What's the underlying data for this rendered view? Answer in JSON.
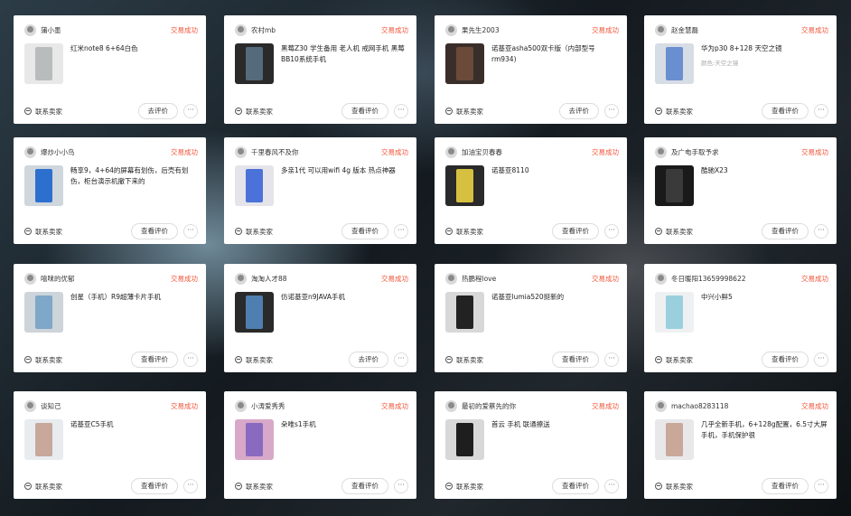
{
  "cards": [
    {
      "seller": "蒲小墨",
      "status": "交易成功",
      "title": "红米note8 6+64白色",
      "sub": "",
      "contact": "联系卖家",
      "review": "去评价",
      "more": "···",
      "thumb": [
        "#e8e8e8",
        "#b9bcbc"
      ]
    },
    {
      "seller": "农村mb",
      "status": "交易成功",
      "title": "黑莓Z30 学生备用 老人机 戒网手机 黑莓BB10系统手机",
      "sub": "",
      "contact": "联系卖家",
      "review": "查看评价",
      "more": "···",
      "thumb": [
        "#2a2a2a",
        "#556a7a"
      ]
    },
    {
      "seller": "果先生2003",
      "status": "交易成功",
      "title": "诺基亚asha500双卡版（内部型号rm934)",
      "sub": "",
      "contact": "联系卖家",
      "review": "去评价",
      "more": "···",
      "thumb": [
        "#3a2e2a",
        "#6b4a3a"
      ]
    },
    {
      "seller": "赵金慧磊",
      "status": "交易成功",
      "title": "华为p30 8+128 天空之镜",
      "sub": "颜色:天空之镜",
      "contact": "联系卖家",
      "review": "查看评价",
      "more": "···",
      "thumb": [
        "#d7dde4",
        "#6a8fd0"
      ]
    },
    {
      "seller": "爆炒小小鸟",
      "status": "交易成功",
      "title": "畅享9，4+64的屏幕有划伤，后壳有划伤，柜台演示机撤下来的",
      "sub": "",
      "contact": "联系卖家",
      "review": "查看评价",
      "more": "···",
      "thumb": [
        "#cfd6dc",
        "#2d6fcf"
      ]
    },
    {
      "seller": "千里春风不及你",
      "status": "交易成功",
      "title": "多亲1代 可以用wifi 4g 版本 热点神器",
      "sub": "",
      "contact": "联系卖家",
      "review": "查看评价",
      "more": "···",
      "thumb": [
        "#e4e4ea",
        "#4a72d8"
      ]
    },
    {
      "seller": "加油宝贝春春",
      "status": "交易成功",
      "title": "诺基亚8110",
      "sub": "",
      "contact": "联系卖家",
      "review": "查看评价",
      "more": "···",
      "thumb": [
        "#2a2a2a",
        "#d6c040"
      ]
    },
    {
      "seller": "及广电手取予求",
      "status": "交易成功",
      "title": "酷驰X23",
      "sub": "",
      "contact": "联系卖家",
      "review": "查看评价",
      "more": "···",
      "thumb": [
        "#1a1a1a",
        "#3a3a3a"
      ]
    },
    {
      "seller": "嘻咪的优郁",
      "status": "交易成功",
      "title": "创星（手机）R9超薄卡片手机",
      "sub": "",
      "contact": "联系卖家",
      "review": "查看评价",
      "more": "···",
      "thumb": [
        "#cdd4da",
        "#7fa7c8"
      ]
    },
    {
      "seller": "淘淘人才88",
      "status": "交易成功",
      "title": "仿诺基亚n9JAVA手机",
      "sub": "",
      "contact": "联系卖家",
      "review": "去评价",
      "more": "···",
      "thumb": [
        "#2a2a2a",
        "#4f7fb0"
      ]
    },
    {
      "seller": "热鹏程love",
      "status": "交易成功",
      "title": "诺基亚lumia520挺新的",
      "sub": "",
      "contact": "联系卖家",
      "review": "查看评价",
      "more": "···",
      "thumb": [
        "#d8d8d8",
        "#222222"
      ]
    },
    {
      "seller": "冬日暖阳13659998622",
      "status": "交易成功",
      "title": "中兴小鲜5",
      "sub": "",
      "contact": "联系卖家",
      "review": "查看评价",
      "more": "···",
      "thumb": [
        "#eef0f2",
        "#9ad0de"
      ]
    },
    {
      "seller": "谈知己",
      "status": "交易成功",
      "title": "诺基亚C5手机",
      "sub": "",
      "contact": "联系卖家",
      "review": "查看评价",
      "more": "···",
      "thumb": [
        "#e8ecef",
        "#c7a89a"
      ]
    },
    {
      "seller": "小涛爱秀秀",
      "status": "交易成功",
      "title": "朵唯s1手机",
      "sub": "",
      "contact": "联系卖家",
      "review": "查看评价",
      "more": "···",
      "thumb": [
        "#d8a8c8",
        "#8a6ac0"
      ]
    },
    {
      "seller": "最初的爱蔡先的你",
      "status": "交易成功",
      "title": "首云 手机 联通擦送",
      "sub": "",
      "contact": "联系卖家",
      "review": "查看评价",
      "more": "···",
      "thumb": [
        "#d8d8d8",
        "#1e1e1e"
      ]
    },
    {
      "seller": "machao8283118",
      "status": "交易成功",
      "title": "几乎全新手机，6+128g配置，6.5寸大屏手机，手机保护很",
      "sub": "",
      "contact": "联系卖家",
      "review": "查看评价",
      "more": "···",
      "thumb": [
        "#e8e8ea",
        "#c9a89a"
      ]
    }
  ]
}
